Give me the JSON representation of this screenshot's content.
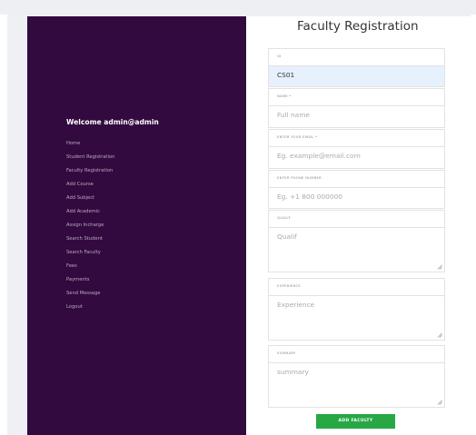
{
  "form": {
    "title": "Faculty Registration",
    "fields": {
      "id": {
        "label": "ID",
        "value": "CS01"
      },
      "name": {
        "label": "NAME *",
        "placeholder": "Full name"
      },
      "email": {
        "label": "ENTER YOUR EMAIL *",
        "placeholder": "Eg. example@email.com"
      },
      "phone": {
        "label": "ENTER PHONE NUMBER",
        "placeholder": "Eg. +1 800 000000"
      },
      "qualif": {
        "label": "QUALIF",
        "placeholder": "Qualif"
      },
      "experience": {
        "label": "EXPERIENCE",
        "placeholder": "Experience"
      },
      "summary": {
        "label": "SUMMARY",
        "placeholder": "summary"
      }
    },
    "submit_label": "ADD FACULTY"
  },
  "sidebar": {
    "welcome": "Welcome admin@admin",
    "items": [
      {
        "label": "Home"
      },
      {
        "label": "Student Registration"
      },
      {
        "label": "Faculty Registration"
      },
      {
        "label": "Add Course"
      },
      {
        "label": "Add Subject"
      },
      {
        "label": "Add Academic"
      },
      {
        "label": "Assign Incharge"
      },
      {
        "label": "Search Student"
      },
      {
        "label": "Search Faculty"
      },
      {
        "label": "Fees"
      },
      {
        "label": "Payments"
      },
      {
        "label": "Send Message"
      },
      {
        "label": "Logout"
      }
    ]
  },
  "colors": {
    "sidebar_bg": "#330a3f",
    "button_bg": "#28a745",
    "autofill_bg": "#e7f0fd"
  }
}
